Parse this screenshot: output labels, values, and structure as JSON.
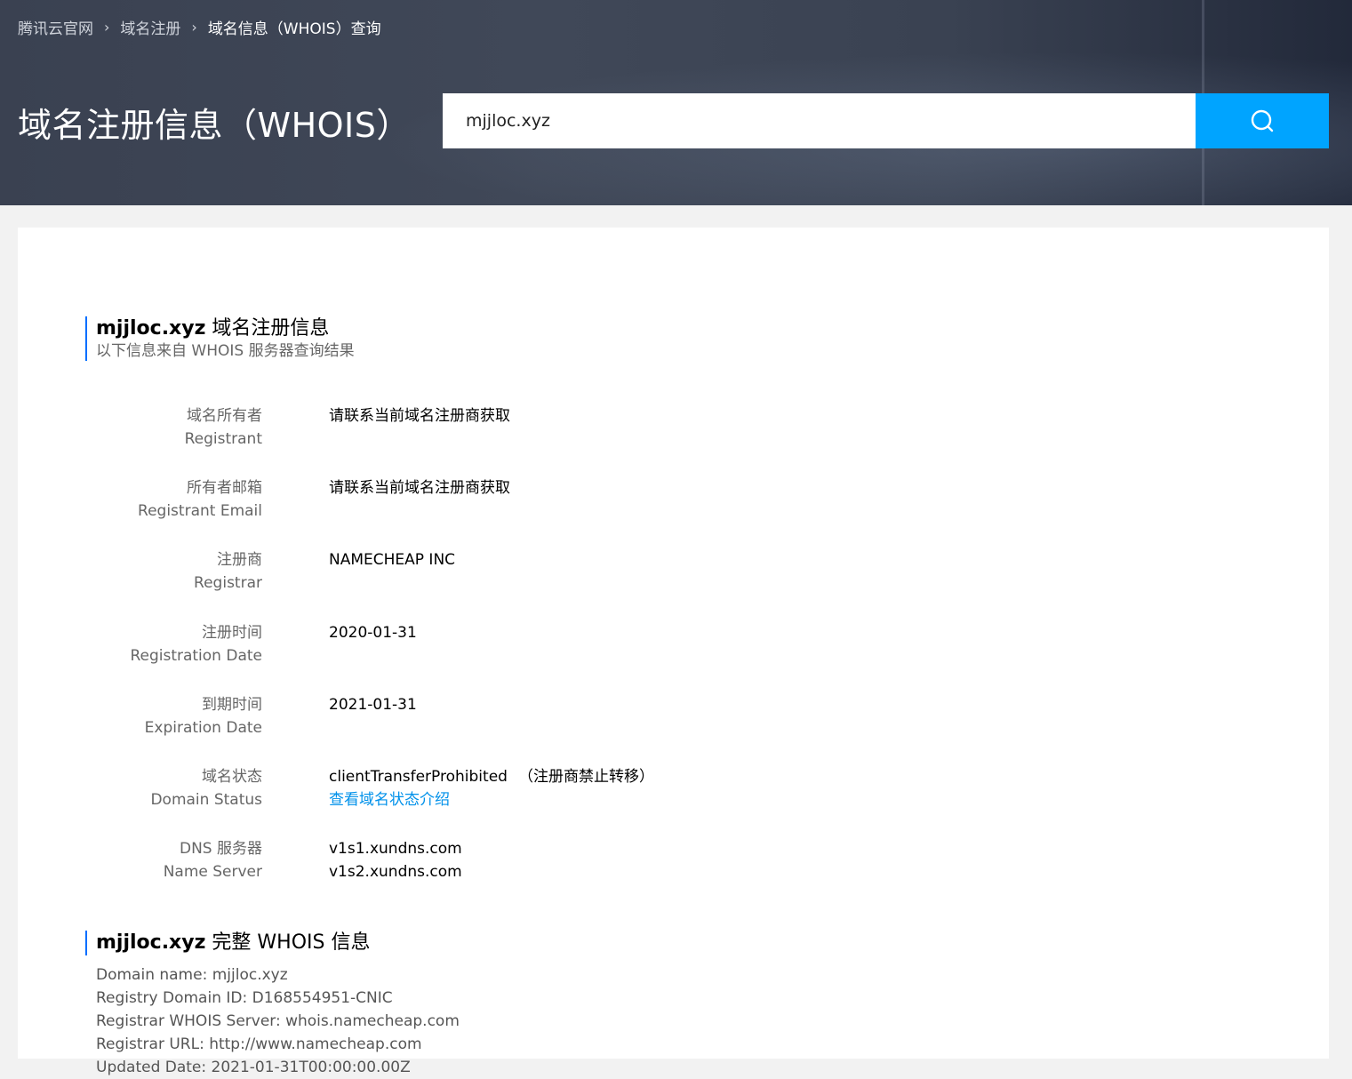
{
  "breadcrumb": {
    "items": [
      "腾讯云官网",
      "域名注册"
    ],
    "current": "域名信息（WHOIS）查询"
  },
  "header": {
    "title": "域名注册信息（WHOIS）"
  },
  "search": {
    "value": "mjjloc.xyz",
    "icon": "search-icon",
    "button_color": "#00a4ff"
  },
  "summary": {
    "domain": "mjjloc.xyz",
    "title_suffix": "域名注册信息",
    "subtitle": "以下信息来自 WHOIS 服务器查询结果",
    "rows": [
      {
        "label_cn": "域名所有者",
        "label_en": "Registrant",
        "value": "请联系当前域名注册商获取"
      },
      {
        "label_cn": "所有者邮箱",
        "label_en": "Registrant Email",
        "value": "请联系当前域名注册商获取"
      },
      {
        "label_cn": "注册商",
        "label_en": "Registrar",
        "value": "NAMECHEAP INC"
      },
      {
        "label_cn": "注册时间",
        "label_en": "Registration Date",
        "value": "2020-01-31"
      },
      {
        "label_cn": "到期时间",
        "label_en": "Expiration Date",
        "value": "2021-01-31"
      }
    ],
    "status": {
      "label_cn": "域名状态",
      "label_en": "Domain Status",
      "value": "clientTransferProhibited",
      "note": "（注册商禁止转移）",
      "link": "查看域名状态介绍"
    },
    "dns": {
      "label_cn": "DNS 服务器",
      "label_en": "Name Server",
      "servers": [
        "v1s1.xundns.com",
        "v1s2.xundns.com"
      ]
    }
  },
  "full_whois": {
    "domain": "mjjloc.xyz",
    "title_suffix": "完整 WHOIS 信息",
    "lines": [
      "Domain name: mjjloc.xyz",
      "Registry Domain ID: D168554951-CNIC",
      "Registrar WHOIS Server: whois.namecheap.com",
      "Registrar URL: http://www.namecheap.com",
      "Updated Date: 2021-01-31T00:00:00.00Z"
    ]
  },
  "colors": {
    "accent": "#006eff",
    "link": "#0091ea"
  }
}
